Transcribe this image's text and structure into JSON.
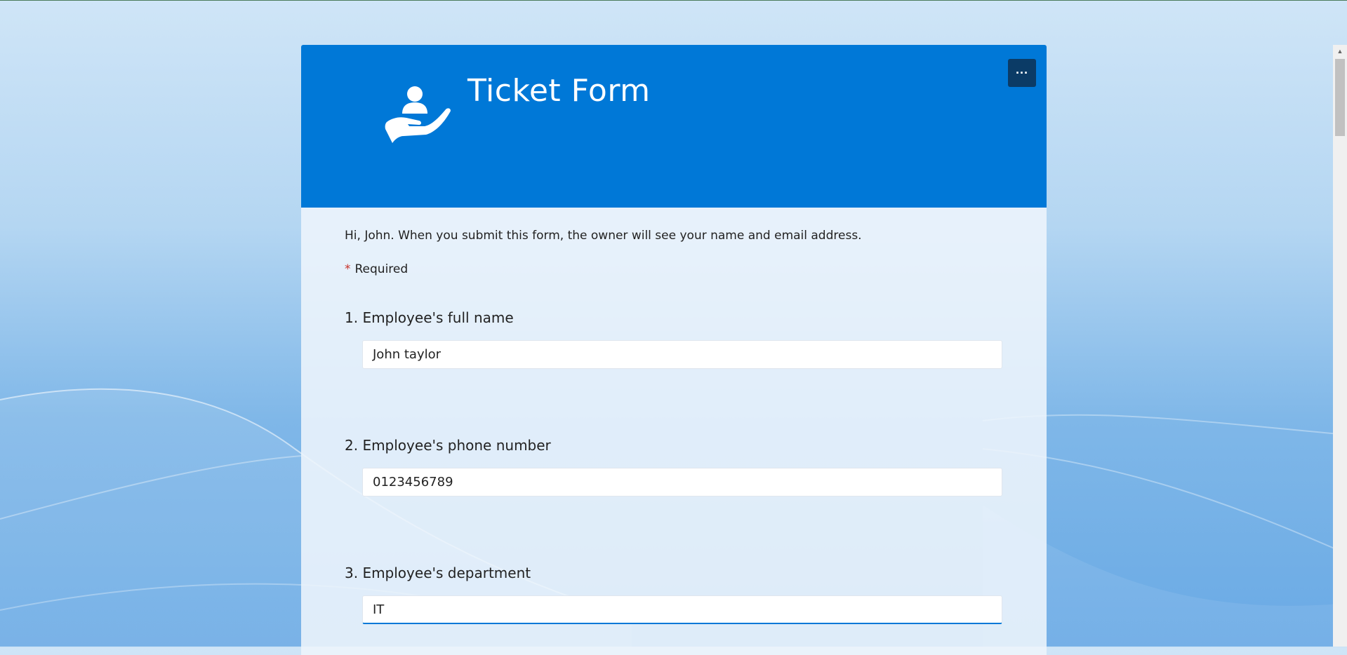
{
  "form": {
    "title": "Ticket Form",
    "more_button": "···",
    "intro": "Hi, John. When you submit this form, the owner will see your name and email address.",
    "required_star": "*",
    "required_label": "Required",
    "questions": [
      {
        "label": "1. Employee's full name",
        "value": "John taylor"
      },
      {
        "label": "2. Employee's phone number",
        "value": "0123456789"
      },
      {
        "label": "3. Employee's department",
        "value": "IT"
      }
    ]
  },
  "icons": {
    "logo": "hand-holding-person-icon",
    "more": "more-options-icon",
    "scroll_up": "chevron-up-icon"
  },
  "colors": {
    "header": "#0078d7",
    "more_button": "#0b3b66",
    "required_star": "#c8322a",
    "focus_underline": "#0078d7"
  }
}
